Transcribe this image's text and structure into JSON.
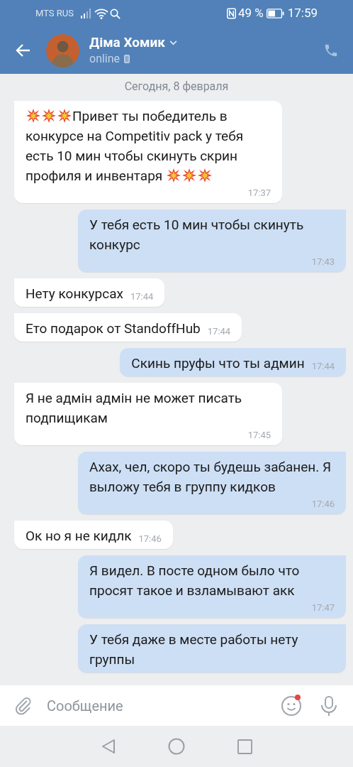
{
  "status_bar": {
    "carrier": "MTS RUS",
    "battery": "49 %",
    "time": "17:59"
  },
  "header": {
    "name": "Діма Хомик",
    "status": "online"
  },
  "date_separator": "Сегодня, 8 февраля",
  "messages": [
    {
      "kind": "incoming",
      "parts": [
        {
          "kind": "emoji"
        },
        {
          "kind": "emoji"
        },
        {
          "kind": "emoji"
        },
        {
          "kind": "text",
          "text": "Привет ты победитель в конкурсе на Competitiv pack у тебя есть 10 мин  чтобы скинуть  скрин профиля и инвентаря "
        },
        {
          "kind": "emoji"
        },
        {
          "kind": "emoji"
        },
        {
          "kind": "emoji"
        }
      ],
      "time": "17:37"
    },
    {
      "kind": "outgoing",
      "parts": [
        {
          "kind": "text",
          "text": "У тебя есть 10 мин чтобы скинуть конкурс"
        }
      ],
      "time": "17:43"
    },
    {
      "kind": "incoming",
      "parts": [
        {
          "kind": "text",
          "text": "Нету конкурсах"
        }
      ],
      "time": "17:44"
    },
    {
      "kind": "incoming",
      "parts": [
        {
          "kind": "text",
          "text": "Ето подарок от StandoffHub"
        }
      ],
      "time": "17:44"
    },
    {
      "kind": "outgoing",
      "parts": [
        {
          "kind": "text",
          "text": "Скинь пруфы что ты админ"
        }
      ],
      "time": "17:44"
    },
    {
      "kind": "incoming",
      "parts": [
        {
          "kind": "text",
          "text": "Я не адмін адмін не может писать подпищикам"
        }
      ],
      "time": "17:45"
    },
    {
      "kind": "outgoing",
      "parts": [
        {
          "kind": "text",
          "text": "Ахах, чел, скоро ты будешь забанен.  Я выложу тебя в группу кидков"
        }
      ],
      "time": "17:46"
    },
    {
      "kind": "incoming",
      "parts": [
        {
          "kind": "text",
          "text": "Ок но я не кидлк"
        }
      ],
      "time": "17:46"
    },
    {
      "kind": "outgoing",
      "parts": [
        {
          "kind": "text",
          "text": "Я видел. В посте одном было что просят такое и взламывают акк"
        }
      ],
      "time": "17:47"
    },
    {
      "kind": "outgoing",
      "parts": [
        {
          "kind": "text",
          "text": "У тебя даже в месте работы нету группы"
        }
      ]
    }
  ],
  "composer": {
    "placeholder": "Сообщение",
    "emoji_badge": true
  }
}
